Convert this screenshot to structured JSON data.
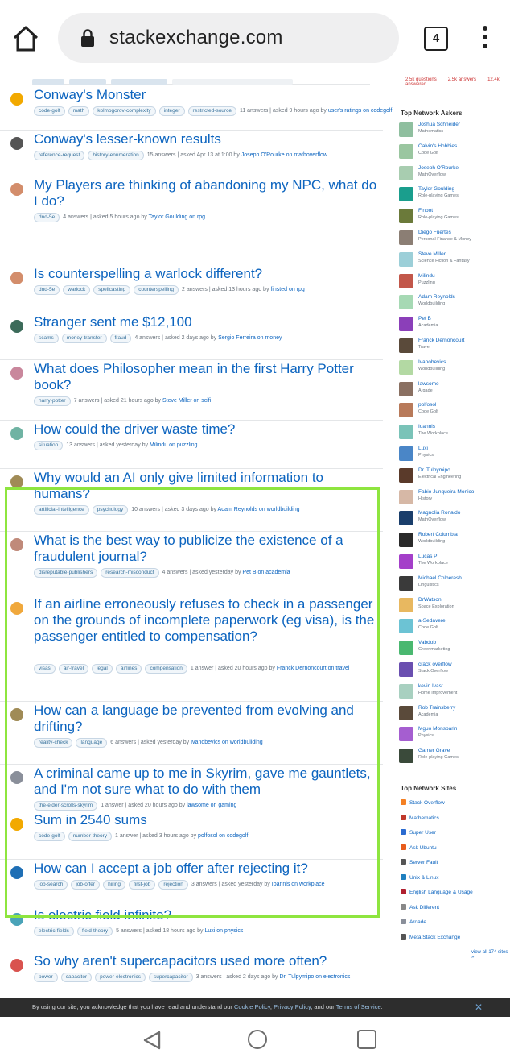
{
  "browser": {
    "url": "stackexchange.com",
    "tab_count": "4"
  },
  "questions": [
    {
      "title": "Conway's Monster",
      "icon_color": "#f2a900",
      "tags": [
        "code-golf",
        "math",
        "kolmogorov-complexity",
        "integer",
        "restricted-source"
      ],
      "info": "11 answers | asked 9 hours ago by",
      "asker": "user's ratings on codegolf"
    },
    {
      "title": "Conway's lesser-known results",
      "icon_color": "#555555",
      "tags": [
        "reference-request",
        "history-enumeration"
      ],
      "info": "15 answers | asked Apr 13 at 1:00 by",
      "asker": "Joseph O'Rourke on mathoverflow"
    },
    {
      "title": "My Players are thinking of abandoning my NPC, what do I do?",
      "icon_color": "#d38d6b",
      "tags": [
        "dnd-5e"
      ],
      "info": "4 answers | asked 5 hours ago by",
      "asker": "Taylor Goulding on rpg"
    },
    {
      "title": "Is counterspelling a warlock different?",
      "icon_color": "#d38d6b",
      "tags": [
        "dnd-5e",
        "warlock",
        "spellcasting",
        "counterspelling"
      ],
      "info": "2 answers | asked 13 hours ago by",
      "asker": "finsted on rpg"
    },
    {
      "title": "Stranger sent me $12,100",
      "icon_color": "#3c6b5a",
      "tags": [
        "scams",
        "money-transfer",
        "fraud"
      ],
      "info": "4 answers | asked 2 days ago by",
      "asker": "Sergio Ferreira on money"
    },
    {
      "title": "What does Philosopher mean in the first Harry Potter book?",
      "icon_color": "#c9879c",
      "tags": [
        "harry-potter"
      ],
      "info": "7 answers | asked 21 hours ago by",
      "asker": "Steve Miller on scifi"
    },
    {
      "title": "How could the driver waste time?",
      "icon_color": "#6fb3a3",
      "tags": [
        "situation"
      ],
      "info": "13 answers | asked yesterday by",
      "asker": "Milindu on puzzling"
    },
    {
      "title": "Why would an AI only give limited information to humans?",
      "icon_color": "#a08b56",
      "tags": [
        "artificial-intelligence",
        "psychology"
      ],
      "info": "10 answers | asked 3 days ago by",
      "asker": "Adam Reynolds on worldbuilding"
    },
    {
      "title": "What is the best way to publicize the existence of a fraudulent journal?",
      "icon_color": "#c08a7a",
      "tags": [
        "disreputable-publishers",
        "research-misconduct"
      ],
      "info": "4 answers | asked yesterday by",
      "asker": "Pet B on academia"
    },
    {
      "title": "If an airline erroneously refuses to check in a passenger on the grounds of incomplete paperwork (eg visa), is the passenger entitled to compensation?",
      "icon_color": "#f0a83c",
      "tags": [
        "visas",
        "air-travel",
        "legal",
        "airlines",
        "compensation"
      ],
      "info": "1 answer | asked 20 hours ago by",
      "asker": "Franck Dernoncourt on travel"
    },
    {
      "title": "How can a language be prevented from evolving and drifting?",
      "icon_color": "#a08b56",
      "tags": [
        "reality-check",
        "language"
      ],
      "info": "6 answers | asked yesterday by",
      "asker": "Ivanobevics on worldbuilding"
    },
    {
      "title": "A criminal came up to me in Skyrim, gave me gauntlets, and I'm not sure what to do with them",
      "icon_color": "#8a8f9a",
      "tags": [
        "the-elder-scrolls-skyrim"
      ],
      "info": "1 answer | asked 20 hours ago by",
      "asker": "lawsome on gaming"
    },
    {
      "title": "Sum in 2540 sums",
      "icon_color": "#f2a900",
      "tags": [
        "code-golf",
        "number-theory"
      ],
      "info": "1 answer | asked 3 hours ago by",
      "asker": "polfosol on codegolf"
    },
    {
      "title": "How can I accept a job offer after rejecting it?",
      "icon_color": "#1f6fb5",
      "tags": [
        "job-search",
        "job-offer",
        "hiring",
        "first-job",
        "rejection"
      ],
      "info": "3 answers | asked yesterday by",
      "asker": "Ioannis on workplace"
    },
    {
      "title": "Is electric field infinite?",
      "icon_color": "#4aa3b8",
      "tags": [
        "electric-fields",
        "field-theory"
      ],
      "info": "5 answers | asked 18 hours ago by",
      "asker": "Luxi on physics"
    },
    {
      "title": "So why aren't supercapacitors used more often?",
      "icon_color": "#d9534f",
      "tags": [
        "power",
        "capacitor",
        "power-electronics",
        "supercapacitor"
      ],
      "info": "3 answers | asked 2 days ago by",
      "asker": "Dr. Tulpymipo on electronics"
    }
  ],
  "sidebar": {
    "stats": [
      "2.5k questions",
      "2.5k answers",
      "12.4k answered"
    ],
    "askers_heading": "Top Network Askers",
    "askers": [
      {
        "name": "Joshua Schneider",
        "site": "Mathematics",
        "color": "#8fbf9f"
      },
      {
        "name": "Calvin's Hobbies",
        "site": "Code Golf",
        "color": "#9ac6a0"
      },
      {
        "name": "Joseph O'Rourke",
        "site": "MathOverflow",
        "color": "#a8cdb0"
      },
      {
        "name": "Taylor Goulding",
        "site": "Role-playing Games",
        "color": "#1a9e8d"
      },
      {
        "name": "Finbot",
        "site": "Role-playing Games",
        "color": "#6b7a3a"
      },
      {
        "name": "Diego Fuertes",
        "site": "Personal Finance & Money",
        "color": "#8b7e74"
      },
      {
        "name": "Steve Miller",
        "site": "Science Fiction & Fantasy",
        "color": "#9ccfd8"
      },
      {
        "name": "Milindu",
        "site": "Puzzling",
        "color": "#c2574a"
      },
      {
        "name": "Adam Reynolds",
        "site": "Worldbuilding",
        "color": "#a6d9b4"
      },
      {
        "name": "Pet B",
        "site": "Academia",
        "color": "#8b3fb9"
      },
      {
        "name": "Franck Dernoncourt",
        "site": "Travel",
        "color": "#5a4a3a"
      },
      {
        "name": "Ivanobevics",
        "site": "Worldbuilding",
        "color": "#b3d9a3"
      },
      {
        "name": "lawsome",
        "site": "Arqade",
        "color": "#8a7062"
      },
      {
        "name": "polfosol",
        "site": "Code Golf",
        "color": "#b87a5a"
      },
      {
        "name": "Ioannis",
        "site": "The Workplace",
        "color": "#7ac3b8"
      },
      {
        "name": "Luxi",
        "site": "Physics",
        "color": "#4a86c7"
      },
      {
        "name": "Dr. Tulpymipo",
        "site": "Electrical Engineering",
        "color": "#5a3a2a"
      },
      {
        "name": "Fabio Junqueira Monico",
        "site": "History",
        "color": "#d6b8a6"
      },
      {
        "name": "Magnolia Ronaldo",
        "site": "MathOverflow",
        "color": "#1a3e6b"
      },
      {
        "name": "Robert Columbia",
        "site": "Worldbuilding",
        "color": "#2a2a2a"
      },
      {
        "name": "Lucas P",
        "site": "The Workplace",
        "color": "#a43fc9"
      },
      {
        "name": "Michael Colberesh",
        "site": "Linguistics",
        "color": "#3a3a3a"
      },
      {
        "name": "DrWatson",
        "site": "Space Exploration",
        "color": "#e8b860"
      },
      {
        "name": "a-Sedavere",
        "site": "Code Golf",
        "color": "#6cc3d4"
      },
      {
        "name": "Vabdob",
        "site": "Greenmarketing",
        "color": "#4ab870"
      },
      {
        "name": "crack overflow",
        "site": "Stack Overflow",
        "color": "#6a4fb0"
      },
      {
        "name": "kevin Ivast",
        "site": "Home Improvement",
        "color": "#a8d0c0"
      },
      {
        "name": "Rob Trainsberry",
        "site": "Academia",
        "color": "#5a4a3a"
      },
      {
        "name": "Mguo Monsbarin",
        "site": "Physics",
        "color": "#a55ed0"
      },
      {
        "name": "Gamer Grave",
        "site": "Role-playing Games",
        "color": "#3a4a3a"
      }
    ],
    "sites_heading": "Top Network Sites",
    "sites": [
      {
        "name": "Stack Overflow",
        "color": "#f48024"
      },
      {
        "name": "Mathematics",
        "color": "#c0392b"
      },
      {
        "name": "Super User",
        "color": "#2a6bd0"
      },
      {
        "name": "Ask Ubuntu",
        "color": "#e85c1c"
      },
      {
        "name": "Server Fault",
        "color": "#555555"
      },
      {
        "name": "Unix & Linux",
        "color": "#1f7fbf"
      },
      {
        "name": "English Language & Usage",
        "color": "#b02030"
      },
      {
        "name": "Ask Different",
        "color": "#888888"
      },
      {
        "name": "Arqade",
        "color": "#8a8f9a"
      },
      {
        "name": "Meta Stack Exchange",
        "color": "#555555"
      }
    ],
    "view_all": "view all 174 sites »"
  },
  "cookie": {
    "text": "By using our site, you acknowledge that you have read and understand our",
    "cookie_policy": "Cookie Policy",
    "privacy_policy": "Privacy Policy",
    "and_our": ", and our",
    "tos": "Terms of Service",
    "close": "✕"
  }
}
